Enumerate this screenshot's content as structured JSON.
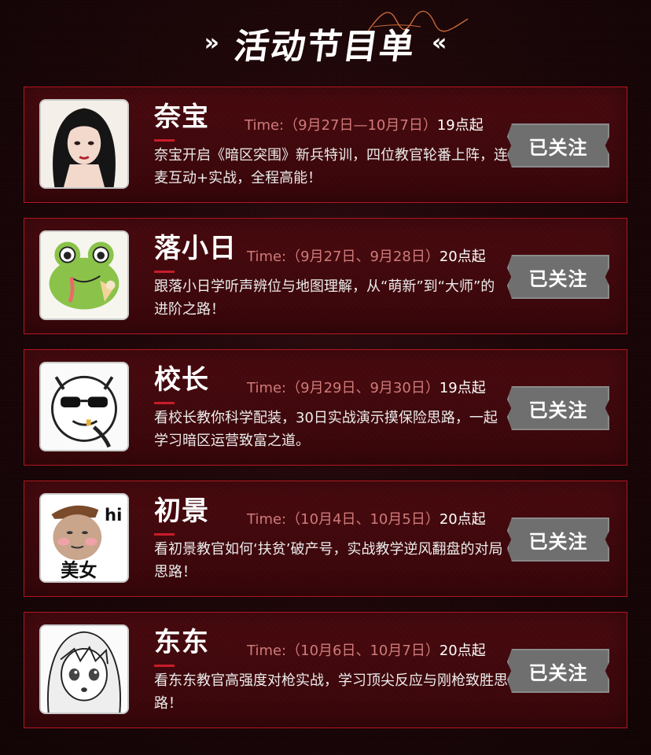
{
  "header": {
    "title": "活动节目单",
    "left_chevron": "»",
    "right_chevron": "«"
  },
  "programs": [
    {
      "name": "奈宝",
      "time_prefix": "Time:（9月27日—10月7日）",
      "time_suffix": "19点起",
      "description": "奈宝开启《暗区突围》新兵特训，四位教官轮番上阵，连麦互动+实战，全程高能！",
      "button_label": "已关注",
      "avatar": "anime-girl-portrait"
    },
    {
      "name": "落小日",
      "time_prefix": "Time:（9月27日、9月28日）",
      "time_suffix": "20点起",
      "description": "跟落小日学听声辨位与地图理解，从“萌新”到“大师”的进阶之路！",
      "button_label": "已关注",
      "avatar": "green-frog-sticker"
    },
    {
      "name": "校长",
      "time_prefix": "Time:（9月29日、9月30日）",
      "time_suffix": "19点起",
      "description": "看校长教你科学配装，30日实战演示摸保险思路，一起学习暗区运营致富之道。",
      "button_label": "已关注",
      "avatar": "sunglasses-meme-face"
    },
    {
      "name": "初景",
      "time_prefix": "Time:（10月4日、10月5日）",
      "time_suffix": "20点起",
      "description": "看初景教官如何‘扶贫’破产号，实战教学逆风翻盘的对局思路！",
      "button_label": "已关注",
      "avatar": "hi-meme-portrait",
      "avatar_text_top": "hi",
      "avatar_text_bottom": "美女"
    },
    {
      "name": "东东",
      "time_prefix": "Time:（10月6日、10月7日）",
      "time_suffix": "20点起",
      "description": "看东东教官高强度对枪实战，学习顶尖反应与刚枪致胜思路！",
      "button_label": "已关注",
      "avatar": "manga-girl-sketch"
    }
  ],
  "colors": {
    "background": "#1a0507",
    "card": "#420a0e",
    "card_border": "#b31622",
    "time_text": "#d07a7a",
    "button": "#6f6f6f"
  }
}
